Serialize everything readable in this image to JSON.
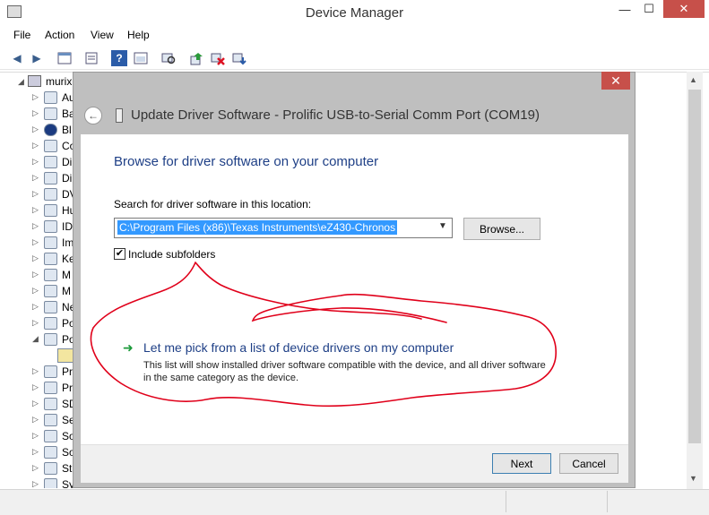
{
  "window": {
    "title": "Device Manager",
    "minimize": "—",
    "maximize": "☐",
    "close": "✕"
  },
  "menu": [
    {
      "label": "File"
    },
    {
      "label": "Action"
    },
    {
      "label": "View"
    },
    {
      "label": "Help"
    }
  ],
  "toolbar_icons": [
    "back-icon",
    "forward-icon",
    "properties-icon",
    "list-icon",
    "help-icon",
    "console-icon",
    "scan-hardware-icon",
    "update-driver-icon",
    "disable-device-icon",
    "uninstall-icon"
  ],
  "tree": {
    "root": "murix",
    "items": [
      {
        "label": "Au",
        "icon": "audio-icon"
      },
      {
        "label": "Ba",
        "icon": "battery-icon"
      },
      {
        "label": "Bl",
        "icon": "bluetooth-icon"
      },
      {
        "label": "Co",
        "icon": "computer-icon"
      },
      {
        "label": "Di",
        "icon": "disk-drive-icon"
      },
      {
        "label": "Di",
        "icon": "display-adapter-icon"
      },
      {
        "label": "DV",
        "icon": "dvd-drive-icon"
      },
      {
        "label": "Hu",
        "icon": "hid-icon"
      },
      {
        "label": "ID",
        "icon": "ide-controller-icon"
      },
      {
        "label": "Im",
        "icon": "imaging-device-icon"
      },
      {
        "label": "Ke",
        "icon": "keyboard-icon"
      },
      {
        "label": "M",
        "icon": "mouse-icon"
      },
      {
        "label": "M",
        "icon": "monitor-icon"
      },
      {
        "label": "Ne",
        "icon": "network-adapter-icon"
      },
      {
        "label": "Po",
        "icon": "portable-device-icon"
      },
      {
        "label": "Po",
        "icon": "ports-icon"
      },
      {
        "label": "",
        "icon": "port-device-warning-icon"
      },
      {
        "label": "Pr",
        "icon": "printer-icon"
      },
      {
        "label": "Pr",
        "icon": "processor-icon"
      },
      {
        "label": "SD",
        "icon": "sd-host-icon"
      },
      {
        "label": "Se",
        "icon": "sensor-icon"
      },
      {
        "label": "So",
        "icon": "software-device-icon"
      },
      {
        "label": "So",
        "icon": "sound-controller-icon"
      },
      {
        "label": "St",
        "icon": "storage-controller-icon"
      },
      {
        "label": "Sy",
        "icon": "system-device-icon"
      }
    ]
  },
  "dialog": {
    "close": "✕",
    "title": "Update Driver Software - Prolific USB-to-Serial Comm Port (COM19)",
    "heading": "Browse for driver software on your computer",
    "search_label": "Search for driver software in this location:",
    "path_value": "C:\\Program Files (x86)\\Texas Instruments\\eZ430-Chronos",
    "browse_label": "Browse...",
    "include_subfolders_label": "Include subfolders",
    "include_subfolders_checked": "✔",
    "pick_title": "Let me pick from a list of device drivers on my computer",
    "pick_desc": "This list will show installed driver software compatible with the device, and all driver software in the same category as the device.",
    "next_label": "Next",
    "cancel_label": "Cancel"
  },
  "colors": {
    "annotation": "#e0001a",
    "link": "#1e3f86",
    "close": "#c7504a",
    "selection": "#3399ff"
  }
}
